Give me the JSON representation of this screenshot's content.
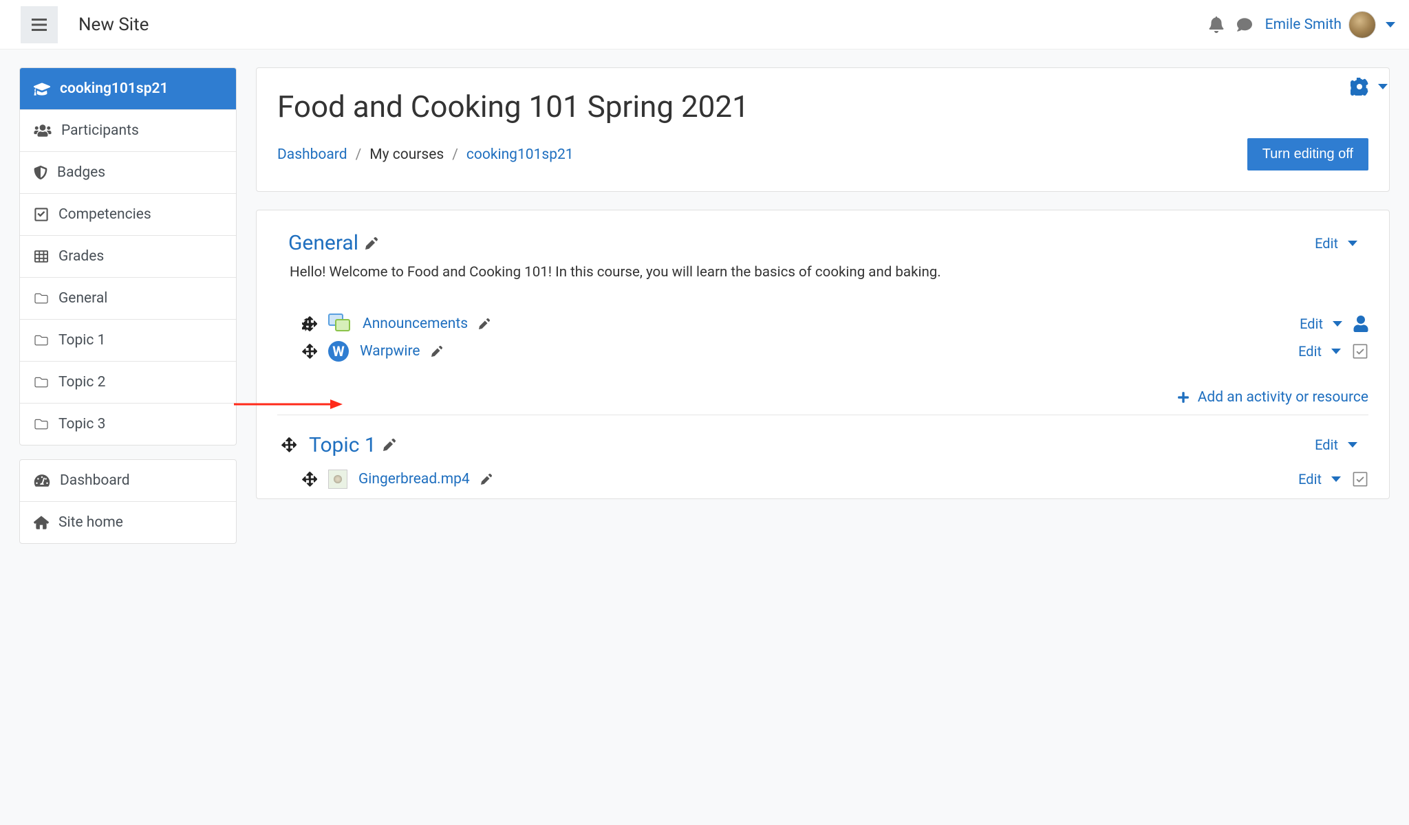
{
  "header": {
    "site_title": "New Site",
    "user_name": "Emile Smith"
  },
  "sidebar": {
    "course_nav": [
      {
        "icon": "graduation-cap-icon",
        "label": "cooking101sp21",
        "active": true
      },
      {
        "icon": "users-icon",
        "label": "Participants"
      },
      {
        "icon": "shield-icon",
        "label": "Badges"
      },
      {
        "icon": "check-square-icon",
        "label": "Competencies"
      },
      {
        "icon": "table-icon",
        "label": "Grades"
      },
      {
        "icon": "folder-icon",
        "label": "General"
      },
      {
        "icon": "folder-icon",
        "label": "Topic 1"
      },
      {
        "icon": "folder-icon",
        "label": "Topic 2"
      },
      {
        "icon": "folder-icon",
        "label": "Topic 3"
      }
    ],
    "site_nav": [
      {
        "icon": "tachometer-icon",
        "label": "Dashboard"
      },
      {
        "icon": "home-icon",
        "label": "Site home"
      }
    ]
  },
  "course": {
    "title": "Food and Cooking 101 Spring 2021",
    "breadcrumb": {
      "dashboard": "Dashboard",
      "mycourses": "My courses",
      "code": "cooking101sp21"
    },
    "turn_editing_off": "Turn editing off",
    "edit_label": "Edit",
    "add_activity": "Add an activity or resource"
  },
  "sections": {
    "general": {
      "title": "General",
      "summary": "Hello! Welcome to Food and Cooking 101! In this course, you will learn the basics of cooking and baking.",
      "activities": [
        {
          "name": "Announcements",
          "type": "forum"
        },
        {
          "name": "Warpwire",
          "type": "warpwire"
        }
      ]
    },
    "topic1": {
      "title": "Topic 1",
      "activities": [
        {
          "name": "Gingerbread.mp4",
          "type": "file"
        }
      ]
    }
  }
}
